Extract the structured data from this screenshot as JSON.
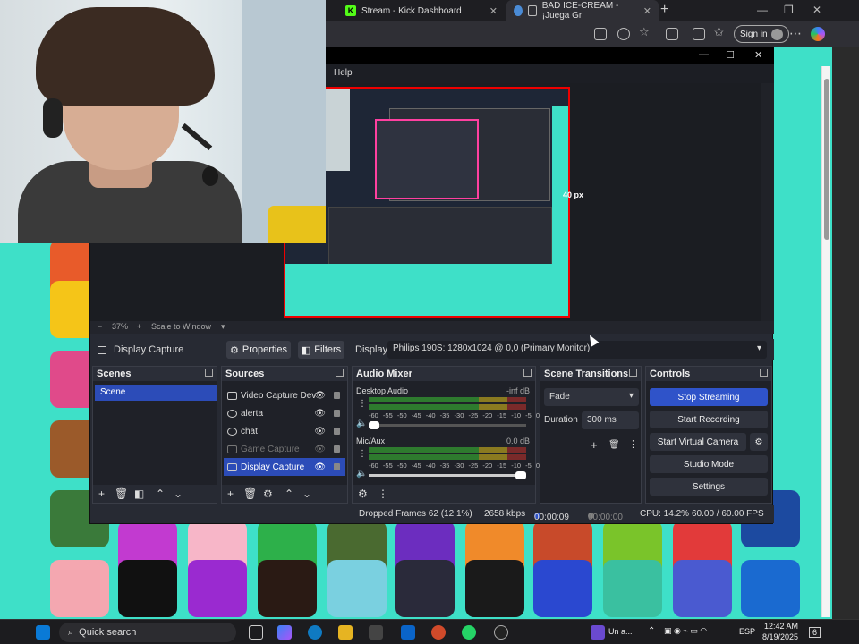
{
  "browser": {
    "tabs": [
      {
        "label": "Stream - Kick Dashboard",
        "icon": "kick-icon"
      },
      {
        "label": "BAD ICE-CREAM - ¡Juega Gr",
        "icon": "muted-speaker-icon"
      }
    ],
    "sign_in": "Sign in",
    "accent": "#2f53c9"
  },
  "obs": {
    "menu": {
      "help": "Help"
    },
    "preview": {
      "size_label": "40 px",
      "zoom": "37%",
      "scale_mode": "Scale to Window"
    },
    "source_bar": {
      "selected_source": "Display Capture",
      "properties": "Properties",
      "filters": "Filters",
      "display_label": "Display",
      "display_value": "Philips 190S: 1280x1024 @ 0,0 (Primary Monitor)"
    },
    "scenes": {
      "title": "Scenes",
      "items": [
        "Scene"
      ]
    },
    "sources": {
      "title": "Sources",
      "items": [
        {
          "label": "Video Capture Dev",
          "icon": "camera-icon"
        },
        {
          "label": "alerta",
          "icon": "globe-icon"
        },
        {
          "label": "chat",
          "icon": "globe-icon"
        },
        {
          "label": "Game Capture",
          "icon": "gamepad-icon"
        },
        {
          "label": "Display Capture",
          "icon": "monitor-icon"
        }
      ]
    },
    "mixer": {
      "title": "Audio Mixer",
      "channels": [
        {
          "name": "Desktop Audio",
          "db": "-inf dB",
          "volume": 0.06
        },
        {
          "name": "Mic/Aux",
          "db": "0.0 dB",
          "volume": 1.0
        }
      ],
      "scale": "-60 -55 -50 -45 -40 -35 -30 -25 -20 -15 -10 -5 0"
    },
    "transitions": {
      "title": "Scene Transitions",
      "type": "Fade",
      "duration_label": "Duration",
      "duration": "300 ms"
    },
    "controls": {
      "title": "Controls",
      "start_stop_streaming": "Stop Streaming",
      "start_recording": "Start Recording",
      "virtual_camera": "Start Virtual Camera",
      "studio_mode": "Studio Mode",
      "settings": "Settings"
    },
    "status": {
      "dropped": "Dropped Frames 62 (12.1%)",
      "bitrate": "2658 kbps",
      "stream_time": "00:00:09",
      "rec_time": "00:00:00",
      "cpu": "CPU: 14.2%",
      "fps": "60.00 / 60.00 FPS"
    }
  },
  "taskbar": {
    "search": "Quick search",
    "notification": "Un a...",
    "lang": "ESP",
    "time": "12:42 AM",
    "date": "8/19/2025",
    "badge": "6"
  }
}
